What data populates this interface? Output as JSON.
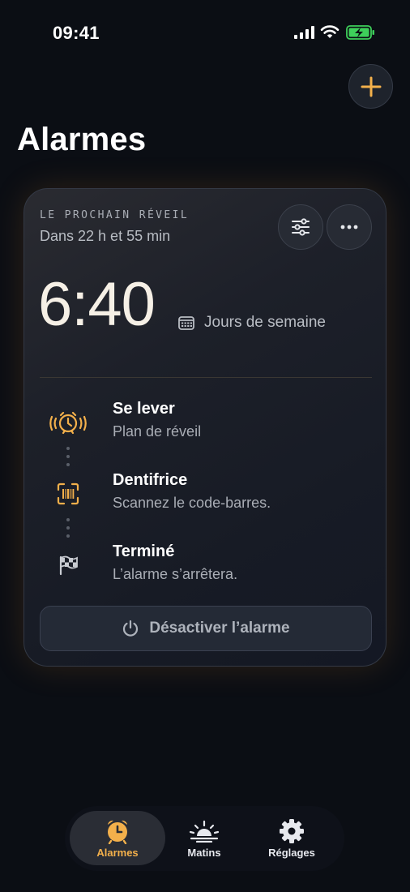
{
  "status_bar": {
    "time": "09:41"
  },
  "header": {
    "title": "Alarmes"
  },
  "next_alarm": {
    "eyebrow": "LE PROCHAIN RÉVEIL",
    "countdown": "Dans 22 h et 55 min",
    "time": "6:40",
    "repeat": "Jours de semaine",
    "steps": [
      {
        "title": "Se lever",
        "subtitle": "Plan de réveil",
        "icon": "alarm-ringing-icon"
      },
      {
        "title": "Dentifrice",
        "subtitle": "Scannez le code-barres.",
        "icon": "barcode-scan-icon"
      },
      {
        "title": "Terminé",
        "subtitle": "L’alarme s’arrêtera.",
        "icon": "checkered-flag-icon"
      }
    ],
    "deactivate_label": "Désactiver l’alarme"
  },
  "tabs": [
    {
      "label": "Alarmes",
      "icon": "alarm-clock-icon",
      "active": true
    },
    {
      "label": "Matins",
      "icon": "sunrise-icon",
      "active": false
    },
    {
      "label": "Réglages",
      "icon": "gear-icon",
      "active": false
    }
  ],
  "colors": {
    "accent": "#f3b04b",
    "background": "#0b0e14",
    "card": "#1d2029"
  }
}
